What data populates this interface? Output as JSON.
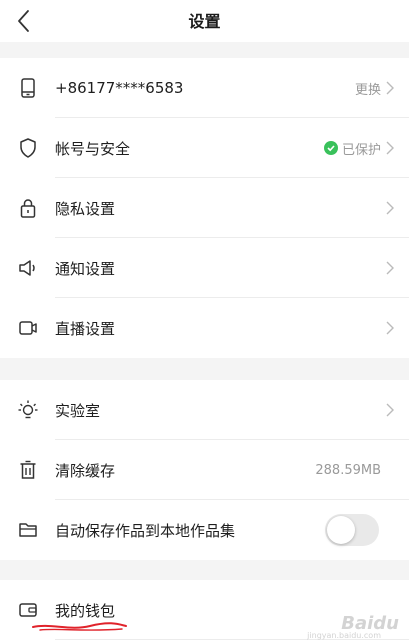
{
  "header": {
    "title": "设置"
  },
  "account": {
    "phone": "+86177****6583",
    "phone_action": "更换",
    "security_label": "帐号与安全",
    "security_status": "已保护",
    "privacy_label": "隐私设置",
    "notify_label": "通知设置",
    "live_label": "直播设置"
  },
  "tools": {
    "lab_label": "实验室",
    "clear_cache_label": "清除缓存",
    "cache_size": "288.59MB",
    "autosave_label": "自动保存作品到本地作品集",
    "autosave_on": false
  },
  "wallet": {
    "label": "我的钱包"
  },
  "watermark": {
    "text": "Baidu",
    "sub": "jingyan.baidu.com"
  },
  "colors": {
    "status_green": "#39c15b",
    "underline_red": "#e0232b"
  }
}
